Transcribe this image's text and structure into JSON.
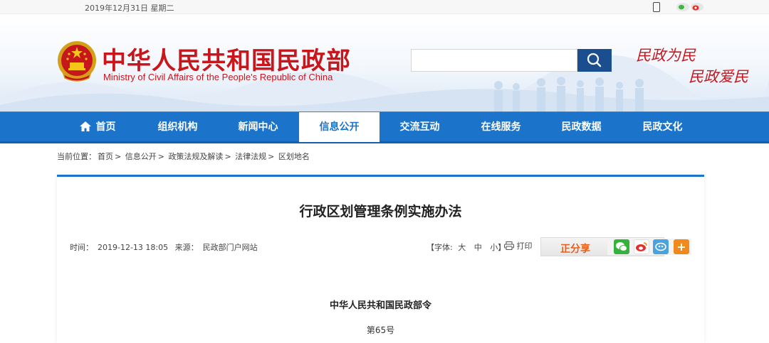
{
  "topbar": {
    "date": "2019年12月31日 星期二"
  },
  "header": {
    "title": "中华人民共和国民政部",
    "subtitle": "Ministry of Civil Affairs of the People's Republic of China",
    "slogan_line1": "民政为民",
    "slogan_line2": "民政爱民",
    "search_placeholder": "",
    "colors": {
      "brand_red": "#c8161d",
      "nav_blue": "#1b74c9",
      "search_button": "#1a4e8f"
    }
  },
  "nav": {
    "items": [
      {
        "label": "首页",
        "icon": "home-icon"
      },
      {
        "label": "组织机构"
      },
      {
        "label": "新闻中心"
      },
      {
        "label": "信息公开",
        "active": true
      },
      {
        "label": "交流互动"
      },
      {
        "label": "在线服务"
      },
      {
        "label": "民政数据"
      },
      {
        "label": "民政文化"
      }
    ]
  },
  "breadcrumb": {
    "prefix": "当前位置：",
    "items": [
      "首页",
      "信息公开",
      "政策法规及解读",
      "法律法规",
      "区划地名"
    ],
    "separator": ">"
  },
  "article": {
    "title": "行政区划管理条例实施办法",
    "time_label": "时间：",
    "time": "2019-12-13 18:05",
    "source_label": "来源：",
    "source": "民政部门户网站",
    "fontsize_open": "【字体:",
    "fontsize_large": "大",
    "fontsize_medium": "中",
    "fontsize_small": "小】",
    "print_label": "打印",
    "share_label": "正分享",
    "share_more": "+",
    "order_title": "中华人民共和国民政部令",
    "order_number": "第65号"
  }
}
